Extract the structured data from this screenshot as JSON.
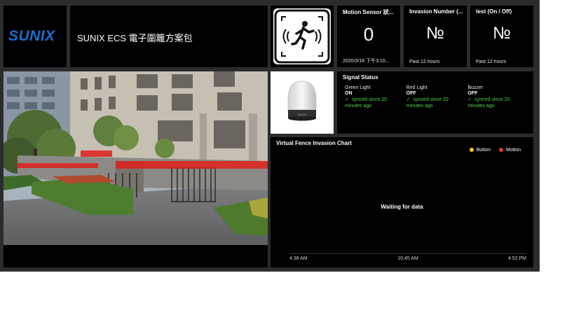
{
  "header": {
    "logo_text": "SUNIX",
    "title": "SUNIX ECS 電子圍籬方案包"
  },
  "tiles": {
    "motion": {
      "title": "Motion Sensor 狀...",
      "value": "0",
      "subtitle": "2020/3/16 下午3:10..."
    },
    "invasion": {
      "title": "Invasion Number (...",
      "value": "№",
      "subtitle": "Past 12 hours"
    },
    "test": {
      "title": "test (On / Off)",
      "value": "№",
      "subtitle": "Past 12 hours"
    }
  },
  "signal": {
    "title": "Signal Status",
    "items": [
      {
        "label": "Green Light",
        "value": "ON",
        "sync": "synced since 20 minutes ago"
      },
      {
        "label": "Red Light",
        "value": "OFF",
        "sync": "synced since 20 minutes ago"
      },
      {
        "label": "Buzzer",
        "value": "OFF",
        "sync": "synced since 20 minutes ago"
      }
    ]
  },
  "chart": {
    "title": "Virtual Fence Invasion Chart",
    "waiting": "Waiting for data",
    "legend": [
      {
        "name": "Button",
        "color": "#f2c12e"
      },
      {
        "name": "Motion",
        "color": "#e03a2f"
      }
    ],
    "xticks": [
      "4:38 AM",
      "10:45 AM",
      "4:52 PM"
    ]
  },
  "icons": {
    "motion_tile": "running-person-motion-icon",
    "device": "signal-tower-light-icon",
    "check": "check-icon"
  },
  "colors": {
    "background": "#2b2c2e",
    "tile": "#000000",
    "accent": "#1a6fd1",
    "synced": "#4bd64b",
    "fence_beam": "#e0201c"
  }
}
